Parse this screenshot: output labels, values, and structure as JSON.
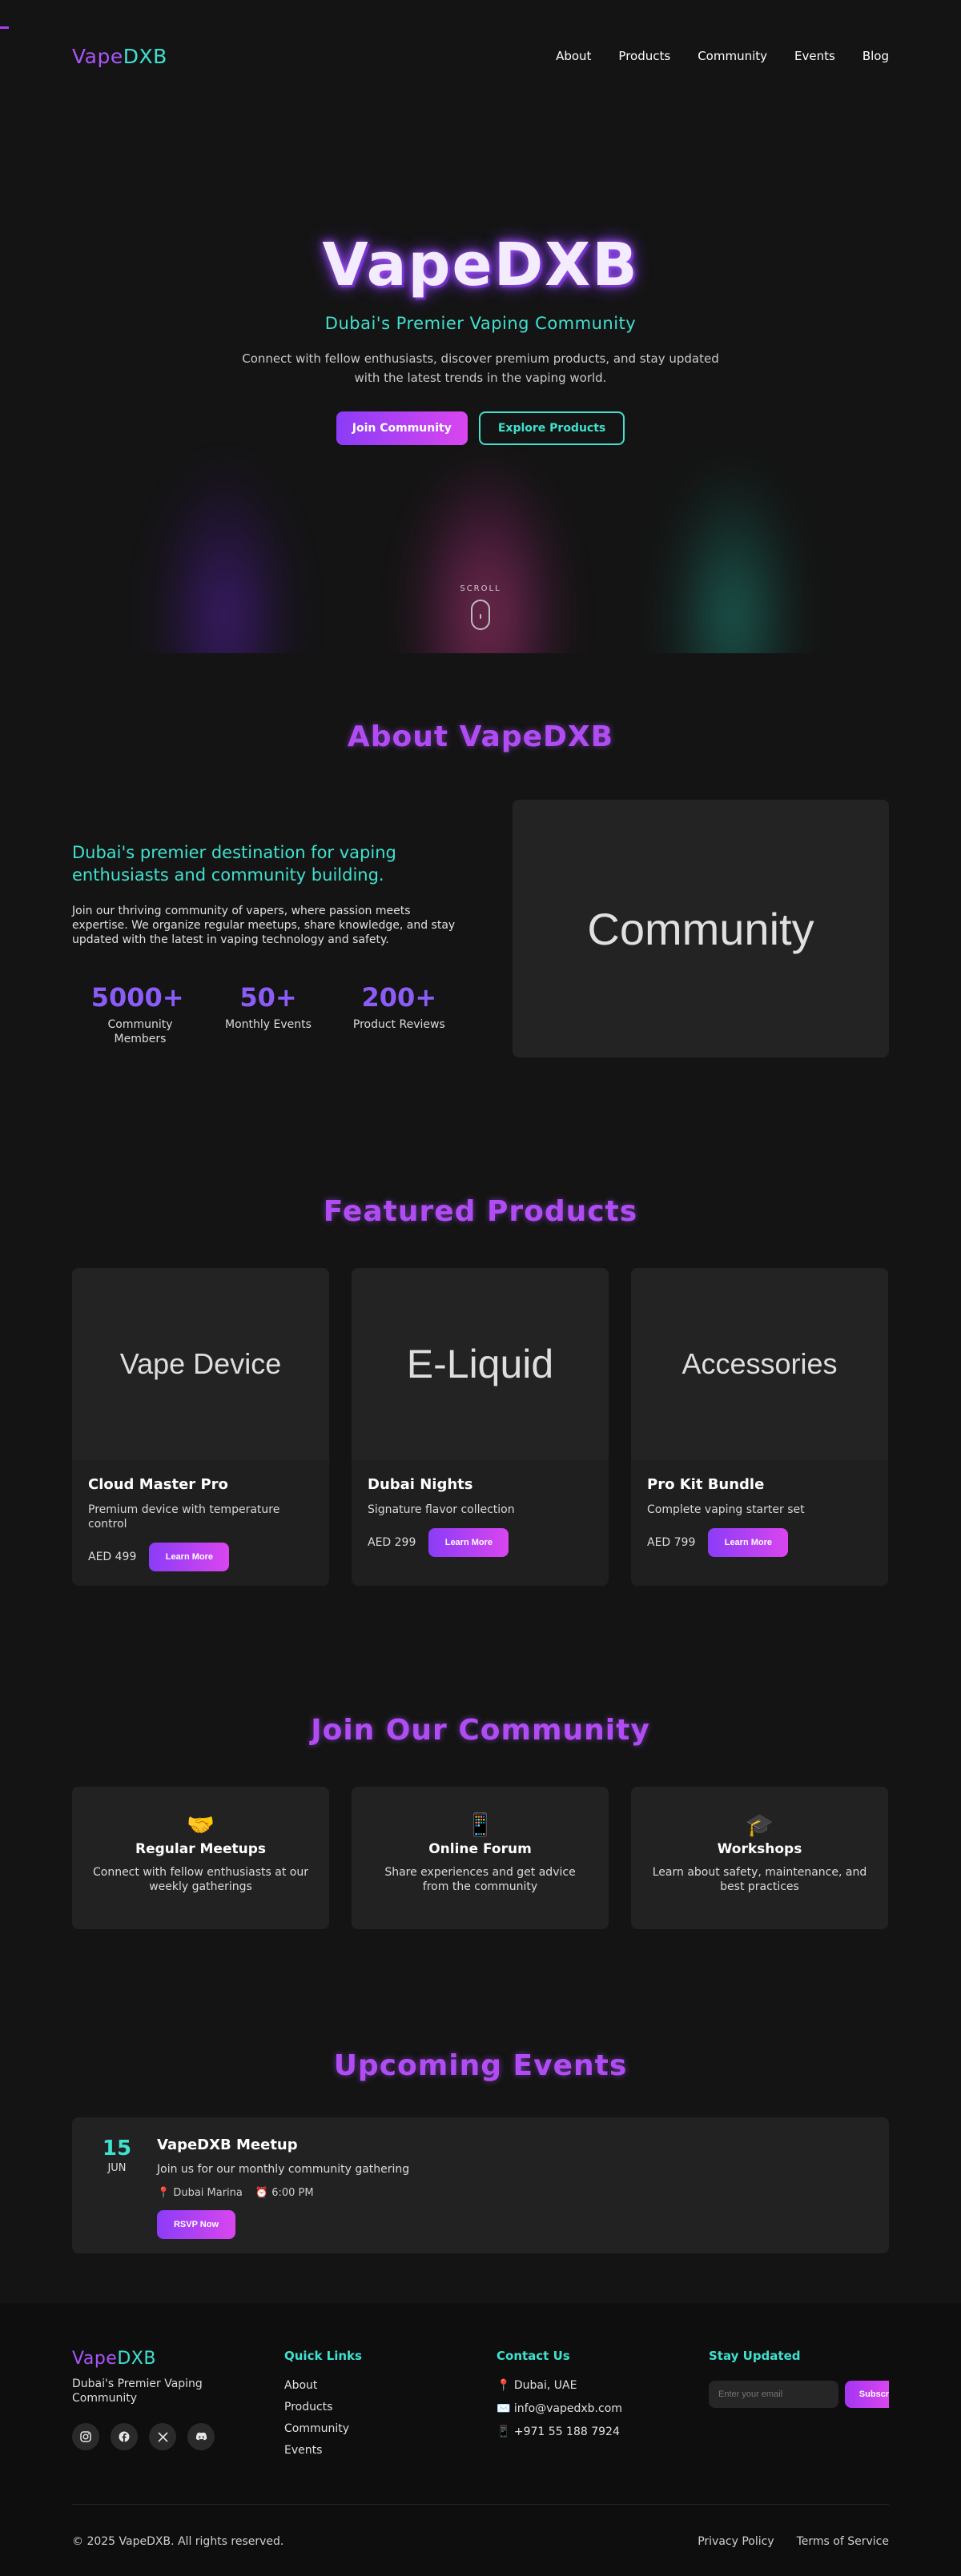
{
  "brand": {
    "part1": "Vape",
    "part2": "DXB"
  },
  "nav": [
    "About",
    "Products",
    "Community",
    "Events",
    "Blog"
  ],
  "hero": {
    "title": "VapeDXB",
    "subtitle": "Dubai's Premier Vaping Community",
    "description": "Connect with fellow enthusiasts, discover premium products, and stay updated with the latest trends in the vaping world.",
    "primary_button": "Join Community",
    "secondary_button": "Explore Products",
    "scroll_label": "SCROLL"
  },
  "about": {
    "title": "About VapeDXB",
    "lead": "Dubai's premier destination for vaping enthusiasts and community building.",
    "text": "Join our thriving community of vapers, where passion meets expertise. We organize regular meetups, share knowledge, and stay updated with the latest in vaping technology and safety.",
    "stats": [
      {
        "value": "5000+",
        "label": "Community Members"
      },
      {
        "value": "50+",
        "label": "Monthly Events"
      },
      {
        "value": "200+",
        "label": "Product Reviews"
      }
    ],
    "image_text": "Community"
  },
  "products": {
    "title": "Featured Products",
    "items": [
      {
        "image_text": "Vape Device",
        "name": "Cloud Master Pro",
        "desc": "Premium device with temperature control",
        "price": "AED 499",
        "button": "Learn More"
      },
      {
        "image_text": "E-Liquid",
        "name": "Dubai Nights",
        "desc": "Signature flavor collection",
        "price": "AED 299",
        "button": "Learn More"
      },
      {
        "image_text": "Accessories",
        "name": "Pro Kit Bundle",
        "desc": "Complete vaping starter set",
        "price": "AED 799",
        "button": "Learn More"
      }
    ]
  },
  "community": {
    "title": "Join Our Community",
    "items": [
      {
        "icon": "🤝",
        "title": "Regular Meetups",
        "desc": "Connect with fellow enthusiasts at our weekly gatherings"
      },
      {
        "icon": "📱",
        "title": "Online Forum",
        "desc": "Share experiences and get advice from the community"
      },
      {
        "icon": "🎓",
        "title": "Workshops",
        "desc": "Learn about safety, maintenance, and best practices"
      }
    ]
  },
  "events": {
    "title": "Upcoming Events",
    "items": [
      {
        "day": "15",
        "month": "JUN",
        "title": "VapeDXB Meetup",
        "desc": "Join us for our monthly community gathering",
        "location": "📍 Dubai Marina",
        "time": "⏰ 6:00 PM",
        "button": "RSVP Now"
      }
    ]
  },
  "footer": {
    "tagline": "Dubai's Premier Vaping Community",
    "socials": [
      "instagram-icon",
      "facebook-icon",
      "x-icon",
      "discord-icon"
    ],
    "quick_links_title": "Quick Links",
    "quick_links": [
      "About",
      "Products",
      "Community",
      "Events"
    ],
    "contact_title": "Contact Us",
    "contact": [
      "📍 Dubai, UAE",
      "✉️ info@vapedxb.com",
      "📱 +971 55 188 7924"
    ],
    "newsletter_title": "Stay Updated",
    "email_placeholder": "Enter your email",
    "subscribe_button": "Subscribe",
    "copyright": "© 2025 VapeDXB. All rights reserved.",
    "legal": [
      "Privacy Policy",
      "Terms of Service"
    ]
  },
  "colors": {
    "purple": "#a855f7",
    "cyan": "#3fe1cf",
    "pink": "#d946ef",
    "bg": "#141414"
  }
}
